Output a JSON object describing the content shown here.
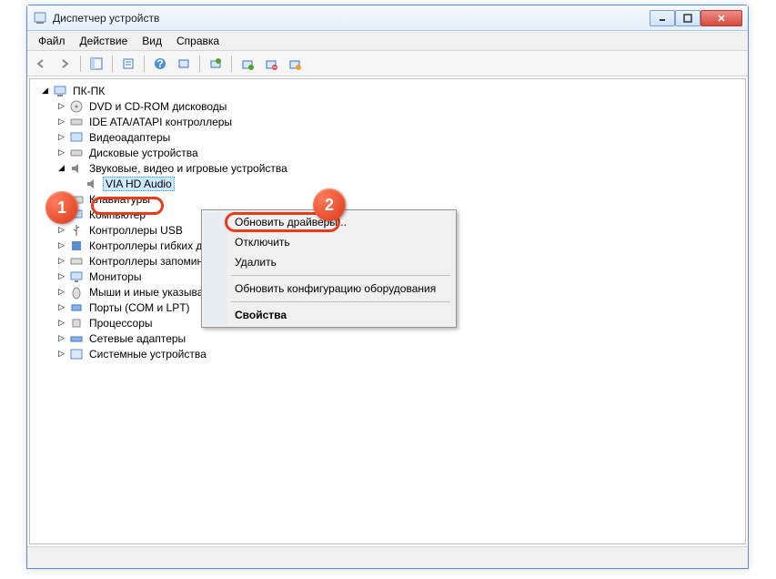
{
  "window": {
    "title": "Диспетчер устройств"
  },
  "menu": {
    "file": "Файл",
    "action": "Действие",
    "view": "Вид",
    "help": "Справка"
  },
  "tree": {
    "root": "ПК-ПК",
    "items": [
      "DVD и CD-ROM дисководы",
      "IDE ATA/ATAPI контроллеры",
      "Видеоадаптеры",
      "Дисковые устройства",
      "Звуковые, видео и игровые устройства",
      "Клавиатуры",
      "Компьютер",
      "Контроллеры USB",
      "Контроллеры гибких дисков",
      "Контроллеры запоминающих устройств",
      "Мониторы",
      "Мыши и иные указывающие устройства",
      "Порты (COM и LPT)",
      "Процессоры",
      "Сетевые адаптеры",
      "Системные устройства"
    ],
    "selected": "VIA HD Audio"
  },
  "context": {
    "update": "Обновить драйверы...",
    "disable": "Отключить",
    "delete": "Удалить",
    "refresh": "Обновить конфигурацию оборудования",
    "props": "Свойства"
  },
  "callouts": {
    "one": "1",
    "two": "2"
  }
}
